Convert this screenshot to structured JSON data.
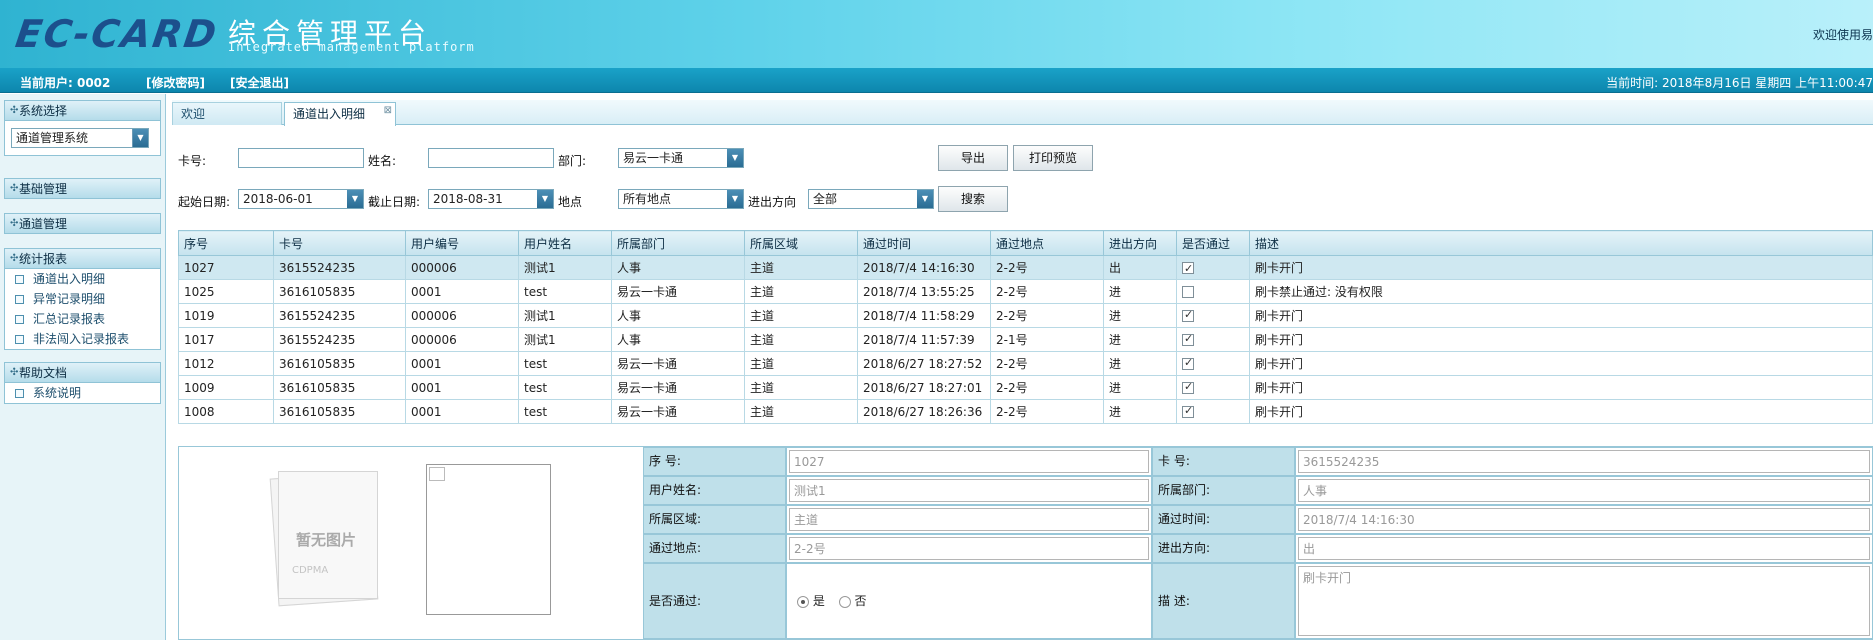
{
  "header": {
    "logo": "EC-CARD",
    "title_cn": "综合管理平台",
    "title_en": "Integrated management platform",
    "welcome": "欢迎使用易"
  },
  "userbar": {
    "current_user": "当前用户: 0002",
    "change_password": "[修改密码]",
    "logout": "[安全退出]",
    "time": "当前时间:  2018年8月16日 星期四 上午11:00:47"
  },
  "sidebar": {
    "system_select": {
      "title": "系统选择",
      "value": "通道管理系统"
    },
    "basic": {
      "title": "基础管理"
    },
    "channel": {
      "title": "通道管理"
    },
    "reports": {
      "title": "统计报表",
      "items": [
        "通道出入明细",
        "异常记录明细",
        "汇总记录报表",
        "非法闯入记录报表"
      ]
    },
    "help": {
      "title": "帮助文档",
      "items": [
        "系统说明"
      ]
    }
  },
  "tabs": [
    {
      "label": "欢迎"
    },
    {
      "label": "通道出入明细"
    }
  ],
  "filters": {
    "card_label": "卡号:",
    "card_value": "",
    "name_label": "姓名:",
    "name_value": "",
    "dept_label": "部门:",
    "dept_value": "易云一卡通",
    "start_label": "起始日期:",
    "start_value": "2018-06-01",
    "end_label": "截止日期:",
    "end_value": "2018-08-31",
    "place_label": "地点",
    "place_value": "所有地点",
    "direction_label": "进出方向",
    "direction_value": "全部",
    "export_btn": "导出",
    "print_btn": "打印预览",
    "search_btn": "搜索"
  },
  "table": {
    "columns": [
      "序号",
      "卡号",
      "用户编号",
      "用户姓名",
      "所属部门",
      "所属区域",
      "通过时间",
      "通过地点",
      "进出方向",
      "是否通过",
      "描述"
    ],
    "rows": [
      [
        "1027",
        "3615524235",
        "000006",
        "测试1",
        "人事",
        "主道",
        "2018/7/4 14:16:30",
        "2-2号",
        "出",
        true,
        "刷卡开门"
      ],
      [
        "1025",
        "3616105835",
        "0001",
        "test",
        "易云一卡通",
        "主道",
        "2018/7/4 13:55:25",
        "2-2号",
        "进",
        false,
        "刷卡禁止通过: 没有权限"
      ],
      [
        "1019",
        "3615524235",
        "000006",
        "测试1",
        "人事",
        "主道",
        "2018/7/4 11:58:29",
        "2-2号",
        "进",
        true,
        "刷卡开门"
      ],
      [
        "1017",
        "3615524235",
        "000006",
        "测试1",
        "人事",
        "主道",
        "2018/7/4 11:57:39",
        "2-1号",
        "进",
        true,
        "刷卡开门"
      ],
      [
        "1012",
        "3616105835",
        "0001",
        "test",
        "易云一卡通",
        "主道",
        "2018/6/27 18:27:52",
        "2-2号",
        "进",
        true,
        "刷卡开门"
      ],
      [
        "1009",
        "3616105835",
        "0001",
        "test",
        "易云一卡通",
        "主道",
        "2018/6/27 18:27:01",
        "2-2号",
        "进",
        true,
        "刷卡开门"
      ],
      [
        "1008",
        "3616105835",
        "0001",
        "test",
        "易云一卡通",
        "主道",
        "2018/6/27 18:26:36",
        "2-2号",
        "进",
        true,
        "刷卡开门"
      ]
    ],
    "selected_index": 0
  },
  "detail": {
    "no_photo": "暂无图片",
    "no_photo_sub": "CDPMA",
    "seq_label": "序  号:",
    "seq_value": "1027",
    "card_label": "卡  号:",
    "card_value": "3615524235",
    "name_label": "用户姓名:",
    "name_value": "测试1",
    "dept_label": "所属部门:",
    "dept_value": "人事",
    "area_label": "所属区域:",
    "area_value": "主道",
    "time_label": "通过时间:",
    "time_value": "2018/7/4 14:16:30",
    "place_label": "通过地点:",
    "place_value": "2-2号",
    "direction_label": "进出方向:",
    "direction_value": "出",
    "pass_label": "是否通过:",
    "pass_yes": "是",
    "pass_no": "否",
    "pass_value": "是",
    "desc_label": "描  述:",
    "desc_value": "刷卡开门"
  },
  "colors": {
    "header_start": "#2fb3d1",
    "userbar": "#0d86ad",
    "logo": "#1c4f8c",
    "selected_row": "#cfe8f1",
    "detail_label_bg": "#bfe0ea"
  }
}
